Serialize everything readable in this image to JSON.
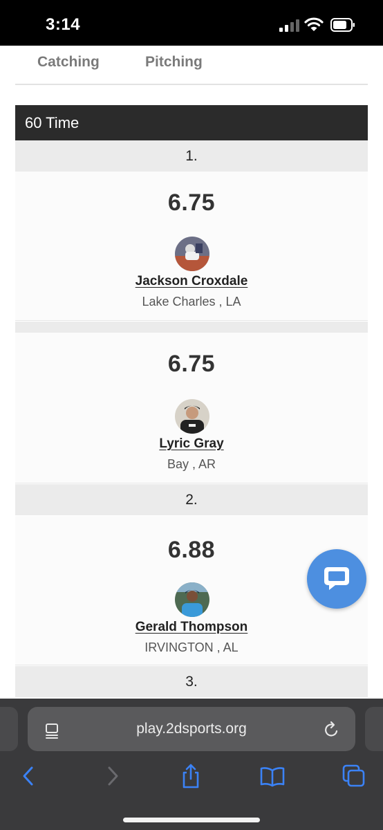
{
  "status_bar": {
    "time": "3:14"
  },
  "tabs": [
    {
      "label": "Catching"
    },
    {
      "label": "Pitching"
    }
  ],
  "section": {
    "title": "60 Time"
  },
  "rankings": [
    {
      "rank": "1."
    },
    {
      "rank": "2."
    },
    {
      "rank": "3."
    }
  ],
  "players": [
    {
      "value": "6.75",
      "name": "Jackson Croxdale",
      "location": "Lake Charles , LA"
    },
    {
      "value": "6.75",
      "name": "Lyric Gray",
      "location": "Bay , AR"
    },
    {
      "value": "6.88",
      "name": "Gerald Thompson",
      "location": "IRVINGTON , AL"
    }
  ],
  "browser": {
    "url": "play.2dsports.org"
  },
  "colors": {
    "header_bg": "#2b2b2b",
    "row_bg": "#ebebeb",
    "chat_button": "#4d8fe0",
    "browser_accent": "#3b82f6"
  },
  "icons": {
    "chat": "chat-bubble-icon",
    "back": "back-arrow-icon",
    "forward": "forward-arrow-icon",
    "share": "share-icon",
    "bookmarks": "bookmarks-icon",
    "tabs": "tabs-icon",
    "reload": "reload-icon",
    "page_menu": "page-menu-icon"
  }
}
